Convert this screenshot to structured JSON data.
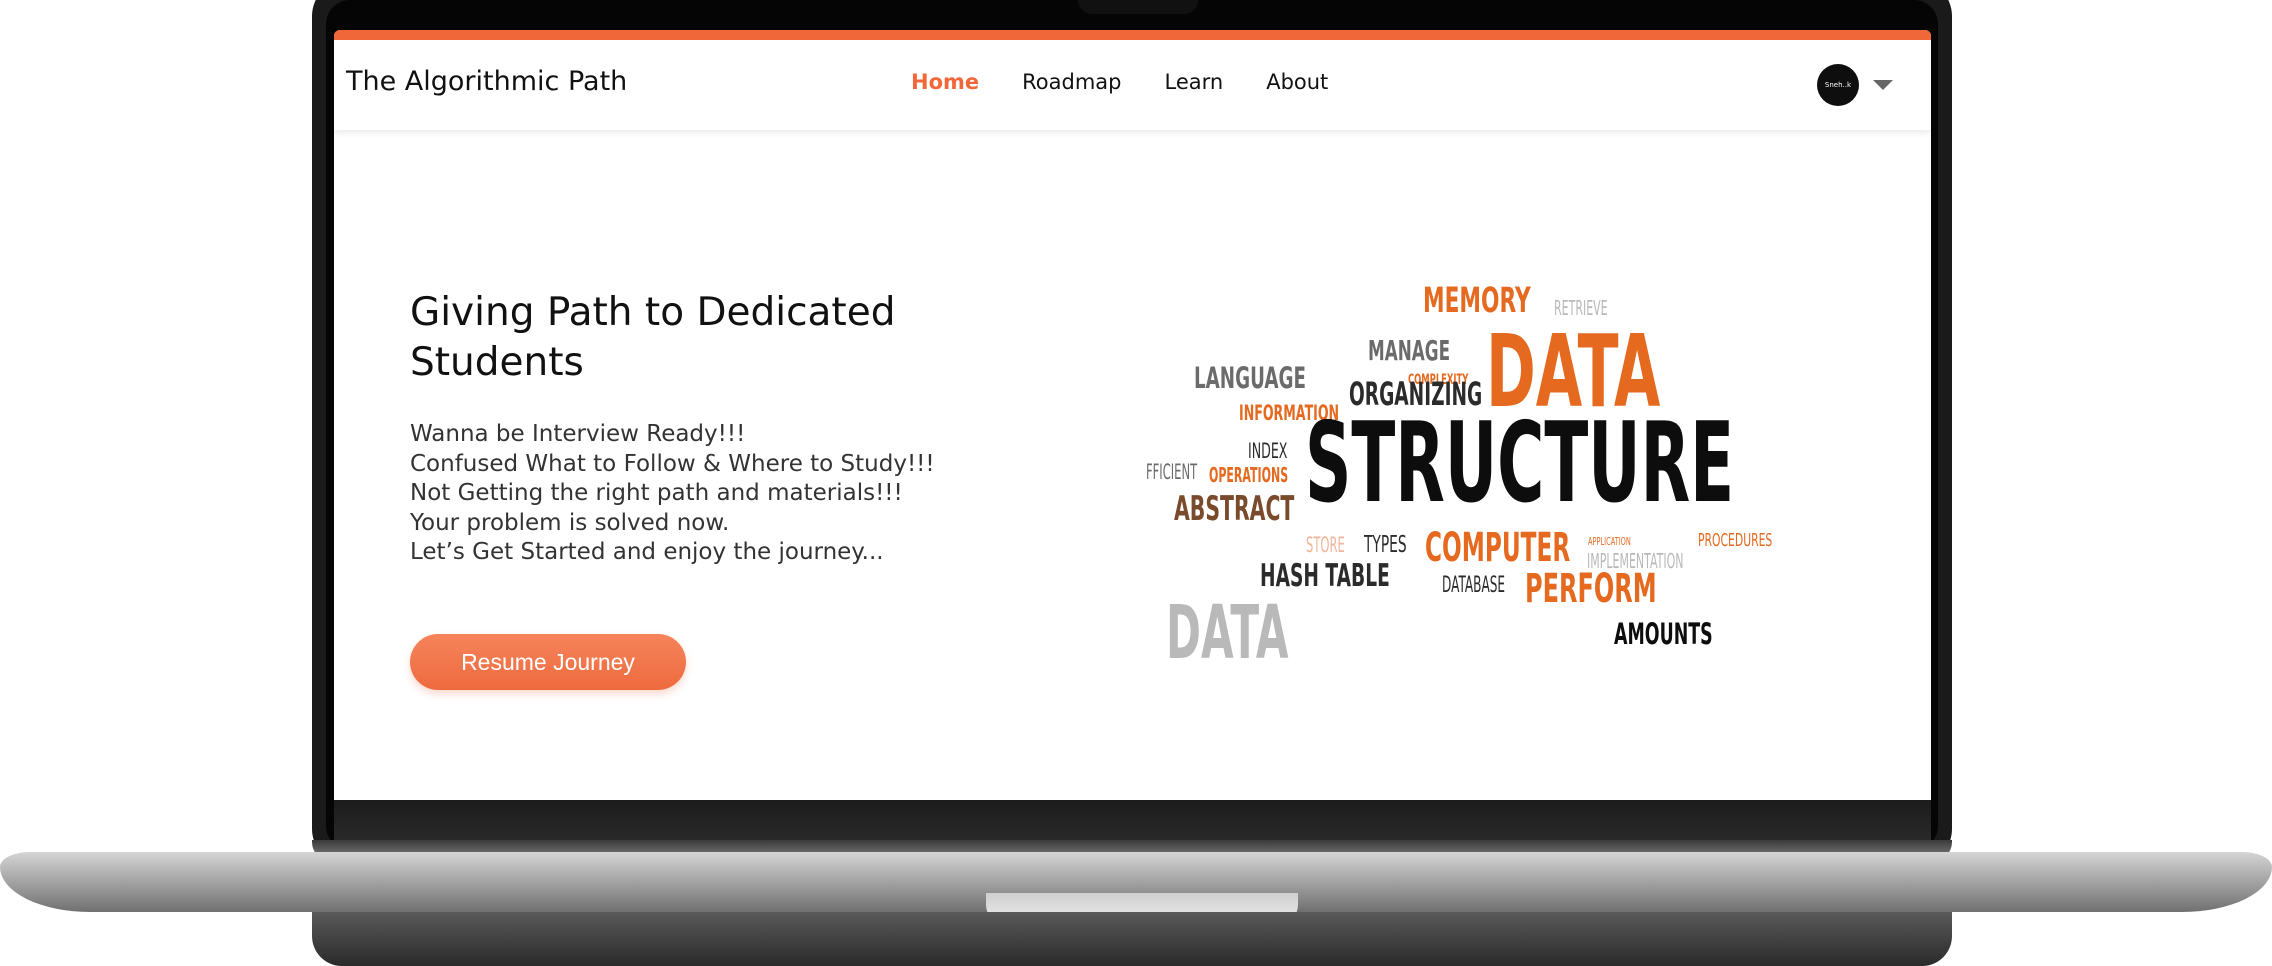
{
  "navbar": {
    "brand": "The Algorithmic Path",
    "links": [
      {
        "label": "Home",
        "active": true
      },
      {
        "label": "Roadmap",
        "active": false
      },
      {
        "label": "Learn",
        "active": false
      },
      {
        "label": "About",
        "active": false
      }
    ],
    "avatar_text": "Sneh..k"
  },
  "hero": {
    "title": "Giving Path to Dedicated Students",
    "lines": [
      "Wanna be Interview Ready!!!",
      "Confused What to Follow & Where to Study!!!",
      "Not Getting the right path and materials!!!",
      "Your problem is solved now.",
      "Let’s Get Started and enjoy the journey..."
    ],
    "button_label": "Resume Journey"
  },
  "word_cloud": {
    "words": [
      "MEMORY",
      "RETRIEVE",
      "MANAGE",
      "DATA",
      "COMPLEXITY",
      "LANGUAGE",
      "ORGANIZING",
      "INFORMATION",
      "INDEX",
      "FFICIENT",
      "OPERATIONS",
      "STRUCTURE",
      "ABSTRACT",
      "STORE",
      "TYPES",
      "COMPUTER",
      "APPLICATION",
      "PROCEDURES",
      "IMPLEMENTATION",
      "HASH TABLE",
      "DATABASE",
      "PERFORM",
      "DATA",
      "AMOUNTS"
    ]
  },
  "colors": {
    "accent": "#f0683a",
    "word_orange": "#e56a1f",
    "word_black": "#0d0d0d"
  }
}
